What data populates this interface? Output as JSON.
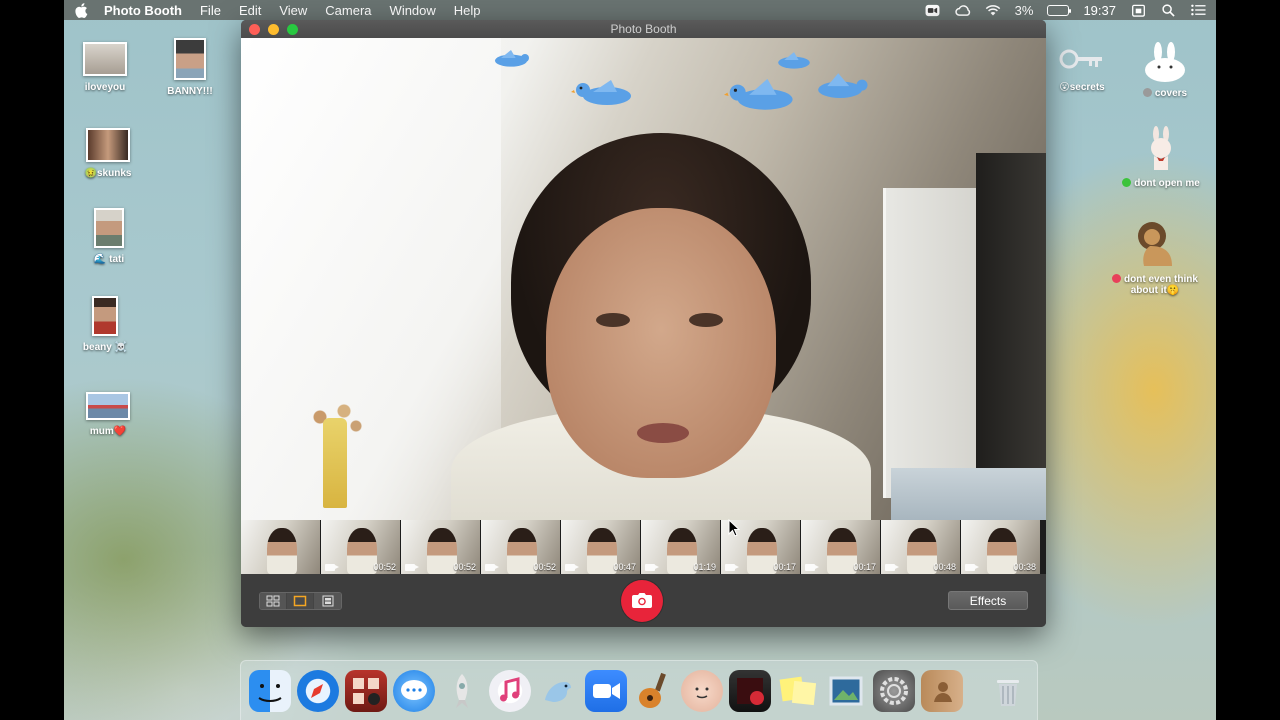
{
  "menubar": {
    "apple_icon": "apple-icon",
    "app_name": "Photo Booth",
    "menus": [
      "File",
      "Edit",
      "View",
      "Camera",
      "Window",
      "Help"
    ],
    "battery_percent": "3%",
    "clock": "19:37"
  },
  "window": {
    "title": "Photo Booth",
    "effects_label": "Effects",
    "filmstrip": [
      {
        "dur": ""
      },
      {
        "dur": "00:52"
      },
      {
        "dur": "00:52"
      },
      {
        "dur": "00:52"
      },
      {
        "dur": "00:47"
      },
      {
        "dur": "01:19"
      },
      {
        "dur": "00:17"
      },
      {
        "dur": "00:17"
      },
      {
        "dur": "00:48"
      },
      {
        "dur": "00:38"
      }
    ]
  },
  "desktop_icons": [
    {
      "label": "iloveyou",
      "tag": ""
    },
    {
      "label": "BANNY!!!",
      "tag": ""
    },
    {
      "label": "skunks",
      "tag": "🤢"
    },
    {
      "label": "tati",
      "tag": "🌊"
    },
    {
      "label": "beany",
      "tag": "☠️"
    },
    {
      "label": "mum",
      "tag": "❤️"
    },
    {
      "label": "secrets",
      "tag": "😮"
    },
    {
      "label": "covers",
      "tag": ""
    },
    {
      "label": "dont open me",
      "tag": ""
    },
    {
      "label": "dont even think about it",
      "tag": "🤫"
    }
  ],
  "colors": {
    "shutter": "#e8243a",
    "tag_green": "#3cc33c",
    "tag_gray": "#9a9a9a",
    "tag_red": "#e8405a"
  }
}
